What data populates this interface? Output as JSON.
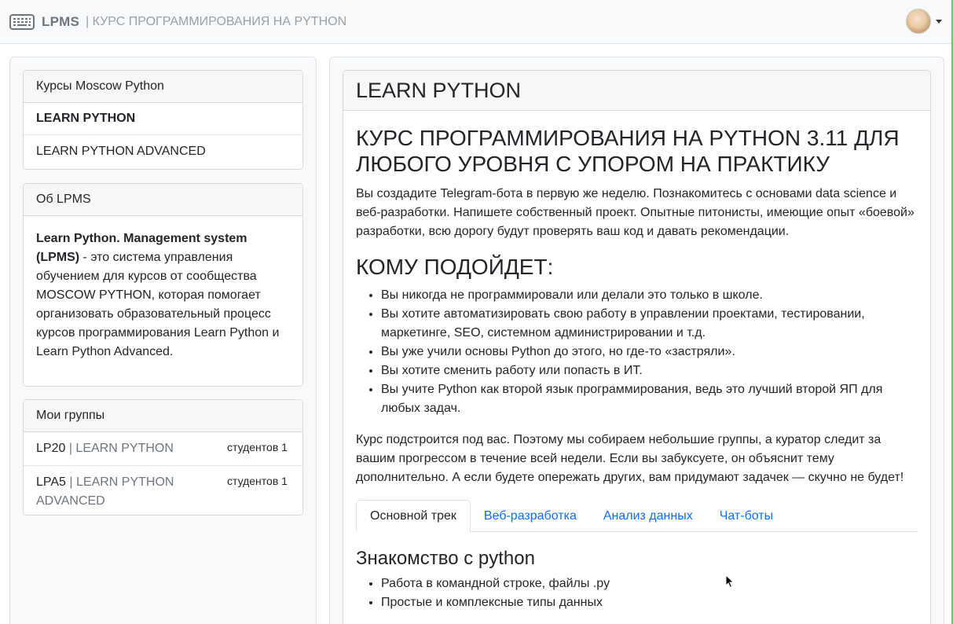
{
  "navbar": {
    "brand": "LPMS",
    "subtitle": "| КУРС ПРОГРАММИРОВАНИЯ НА PYTHON",
    "brand_icon": "keyboard-icon",
    "user_icon": "avatar"
  },
  "courses": {
    "header": "Курсы Moscow Python",
    "items": [
      {
        "label": "LEARN PYTHON",
        "active": true
      },
      {
        "label": "LEARN PYTHON ADVANCED",
        "active": false
      }
    ]
  },
  "about": {
    "header": "Об LPMS",
    "title_bold": "Learn Python. Management system (LPMS)",
    "text": " - это система управления обучением для курсов от сообщества MOSCOW PYTHON, которая помогает организовать образовательный процесс курсов программирования Learn Python и Learn Python Advanced."
  },
  "groups": {
    "header": "Мои группы",
    "items": [
      {
        "code": "LP20",
        "sep": " | ",
        "course": "LEARN PYTHON",
        "count": "студентов 1"
      },
      {
        "code": "LPA5",
        "sep": " | ",
        "course": "LEARN PYTHON ADVANCED",
        "count": "студентов 1"
      }
    ]
  },
  "main": {
    "header": "LEARN PYTHON",
    "title": "КУРС ПРОГРАММИРОВАНИЯ НА PYTHON 3.11 ДЛЯ ЛЮБОГО УРОВНЯ С УПОРОМ НА ПРАКТИКУ",
    "intro": "Вы создадите Telegram-бота в первую же неделю. Познакомитесь с основами data science и веб-разработки. Напишете собственный проект. Опытные питонисты, имеющие опыт «боевой» разработки, всю дорогу будут проверять ваш код и давать рекомендации.",
    "who_title": "КОМУ ПОДОЙДЕТ:",
    "who": [
      "Вы никогда не программировали или делали это только в школе.",
      "Вы хотите автоматизировать свою работу в управлении проектами, тестировании, маркетинге, SEO, системном администрировании и т.д.",
      "Вы уже учили основы Python до этого, но где-то «застряли».",
      "Вы хотите сменить работу или попасть в ИТ.",
      "Вы учите Python как второй язык программирования, ведь это лучший второй ЯП для любых задач."
    ],
    "adapt": "Курс подстроится под вас. Поэтому мы собираем небольшие группы, а куратор следит за вашим прогрессом в течение всей недели. Если вы забуксуете, он объяснит тему дополнительно. А если будете опережать других, вам придумают задачек — скучно не будет!",
    "tabs": [
      {
        "label": "Основной трек",
        "active": true
      },
      {
        "label": "Веб-разработка",
        "active": false
      },
      {
        "label": "Анализ данных",
        "active": false
      },
      {
        "label": "Чат-боты",
        "active": false
      }
    ],
    "section_title": "Знакомство с python",
    "topics": [
      "Работа в командной строке, файлы .py",
      "Простые и комплексные типы данных"
    ]
  }
}
